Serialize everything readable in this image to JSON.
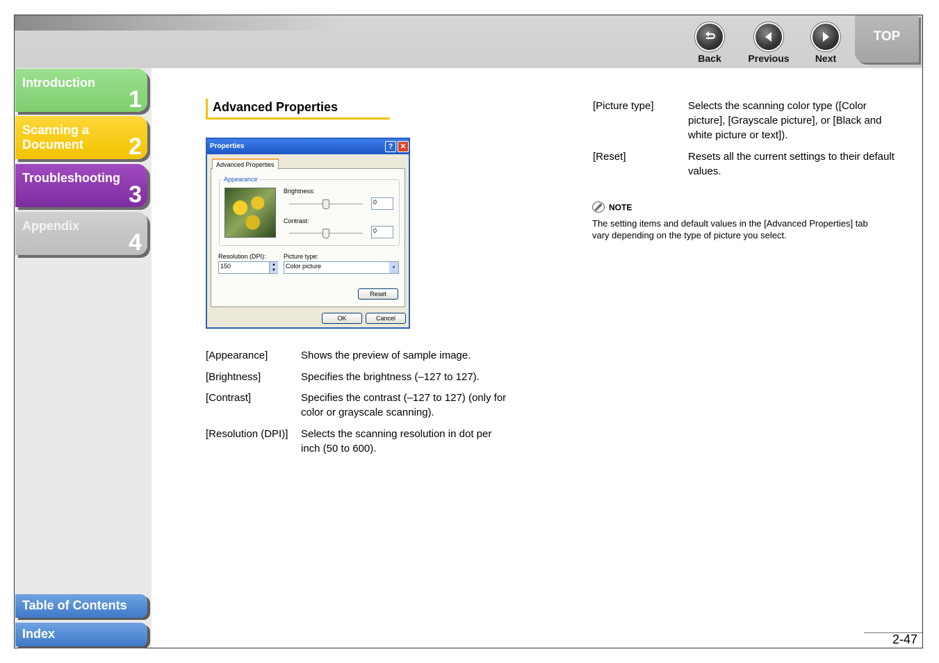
{
  "nav": {
    "back": "Back",
    "previous": "Previous",
    "next": "Next",
    "top": "TOP"
  },
  "sidebar": {
    "chapters": [
      {
        "label": "Introduction",
        "number": "1"
      },
      {
        "label": "Scanning a Document",
        "line1": "Scanning a",
        "line2": "Document",
        "number": "2"
      },
      {
        "label": "Troubleshooting",
        "number": "3"
      },
      {
        "label": "Appendix",
        "number": "4"
      }
    ],
    "toc": "Table of Contents",
    "index": "Index"
  },
  "heading": "Advanced Properties",
  "dialog": {
    "title": "Properties",
    "tab": "Advanced Properties",
    "group": "Appearance",
    "brightness_label": "Brightness:",
    "brightness_value": "0",
    "contrast_label": "Contrast:",
    "contrast_value": "0",
    "resolution_label": "Resolution (DPI):",
    "resolution_value": "150",
    "picture_type_label": "Picture type:",
    "picture_type_value": "Color picture",
    "reset": "Reset",
    "ok": "OK",
    "cancel": "Cancel"
  },
  "left_items": [
    {
      "term": "[Appearance]",
      "line1": "Shows the preview of sample image.",
      "line2": ""
    },
    {
      "term": "[Brightness]",
      "line1": "Specifies the brightness (–127 to 127).",
      "line2": ""
    },
    {
      "term": "[Contrast]",
      "line1": "Specifies the contrast (–127 to 127) (only for",
      "line2": "color or grayscale scanning)."
    },
    {
      "term": "[Resolution (DPI)]",
      "line1": "Selects the scanning resolution in dot per",
      "line2": "inch (50 to 600)."
    }
  ],
  "right_items": [
    {
      "term": "[Picture type]",
      "line1": "Selects the scanning color type ([Color",
      "line2": "picture], [Grayscale picture], or [Black and",
      "line3": "white picture or text])."
    },
    {
      "term": "[Reset]",
      "line1": "Resets all the current settings to their default",
      "line2": "values.",
      "line3": ""
    }
  ],
  "note": {
    "label": "NOTE",
    "line1": "The setting items and default values in the [Advanced Properties] tab",
    "line2": "vary depending on the type of picture you select."
  },
  "page_number": "2-47",
  "colors": {
    "chapter1": "#7fcf70",
    "chapter2": "#f2c300",
    "chapter3": "#7d2ca0",
    "chapter4": "#bdbdbd",
    "link_blue": "#3f79c8",
    "heading_accent": "#f2c300"
  }
}
